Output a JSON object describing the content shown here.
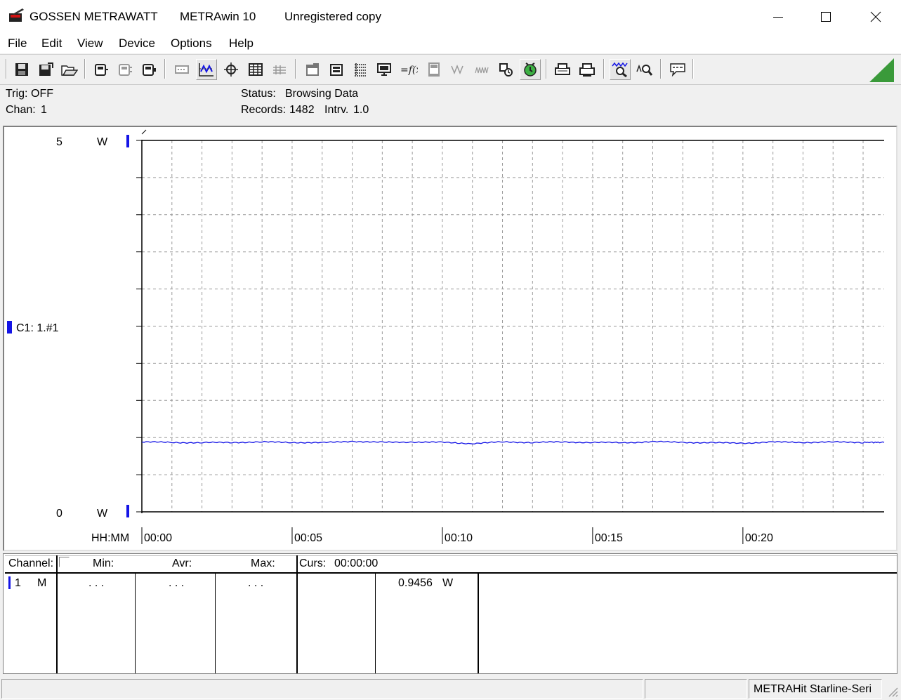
{
  "window": {
    "brand": "GOSSEN METRAWATT",
    "app_name": "METRAwin 10",
    "registration": "Unregistered copy"
  },
  "menu": [
    "File",
    "Edit",
    "View",
    "Device",
    "Options",
    "Help"
  ],
  "toolbar": {
    "buttons": [
      {
        "icon": "save-icon"
      },
      {
        "icon": "save-as-icon"
      },
      {
        "icon": "open-folder-icon"
      },
      {
        "icon": "device-read-icon"
      },
      {
        "icon": "device-config-icon"
      },
      {
        "icon": "device-memory-icon"
      },
      {
        "icon": "record-icon"
      },
      {
        "icon": "yt-view-icon"
      },
      {
        "icon": "xy-view-icon"
      },
      {
        "icon": "table-view-icon"
      },
      {
        "icon": "list-view-icon"
      },
      {
        "icon": "window-icon"
      },
      {
        "icon": "window-list-icon"
      },
      {
        "icon": "grid-table-icon"
      },
      {
        "icon": "monitor-icon"
      },
      {
        "icon": "function-icon"
      },
      {
        "icon": "meter-icon"
      },
      {
        "icon": "wave-icon"
      },
      {
        "icon": "noise-icon"
      },
      {
        "icon": "settings-icon"
      },
      {
        "icon": "clock-run-icon"
      },
      {
        "icon": "print-preview-icon"
      },
      {
        "icon": "print-icon"
      },
      {
        "icon": "zoom-wave-icon"
      },
      {
        "icon": "zoom-icon"
      },
      {
        "icon": "comment-icon"
      }
    ]
  },
  "status_info": {
    "trig_label": "Trig:",
    "trig_value": "OFF",
    "chan_label": "Chan:",
    "chan_value": "1",
    "status_label": "Status:",
    "status_value": "Browsing Data",
    "records_label": "Records:",
    "records_value": "1482",
    "interval_label": "Intrv.",
    "interval_value": "1.0"
  },
  "chart_data": {
    "type": "line",
    "channel_label": "C1: 1.#1",
    "series_color": "#1414e6",
    "y_unit": "W",
    "ylim": [
      0,
      5
    ],
    "y_tick_labels": [
      "5",
      "0"
    ],
    "x_label": "HH:MM",
    "x_tick_labels": [
      "00:00",
      "00:05",
      "00:10",
      "00:15",
      "00:20"
    ],
    "x_tick_minutes": [
      0,
      5,
      10,
      15,
      20
    ],
    "xlim_minutes": [
      0,
      24.7
    ],
    "grid": true,
    "series": [
      {
        "x_minutes": [
          0,
          1,
          2,
          3,
          4,
          5,
          6,
          7,
          8,
          9,
          10,
          11,
          12,
          13,
          14,
          15,
          16,
          17,
          18,
          19,
          20,
          21,
          22,
          23,
          24,
          24.7
        ],
        "values": [
          0.94,
          0.935,
          0.93,
          0.935,
          0.94,
          0.935,
          0.93,
          0.95,
          0.935,
          0.94,
          0.935,
          0.92,
          0.94,
          0.935,
          0.94,
          0.935,
          0.93,
          0.945,
          0.935,
          0.93,
          0.925,
          0.94,
          0.935,
          0.94,
          0.935,
          0.935
        ]
      }
    ]
  },
  "data_table": {
    "headers": {
      "channel": "Channel:",
      "min": "Min:",
      "avr": "Avr:",
      "max": "Max:",
      "curs": "Curs:",
      "curs_time": "00:00:00"
    },
    "row": {
      "channel": "1",
      "mode": "M",
      "min": ". . .",
      "avr": ". . .",
      "max": ". . .",
      "cursor_value": "0.9456",
      "cursor_unit": "W"
    }
  },
  "statusbar": {
    "device": "METRAHit Starline-Seri"
  }
}
